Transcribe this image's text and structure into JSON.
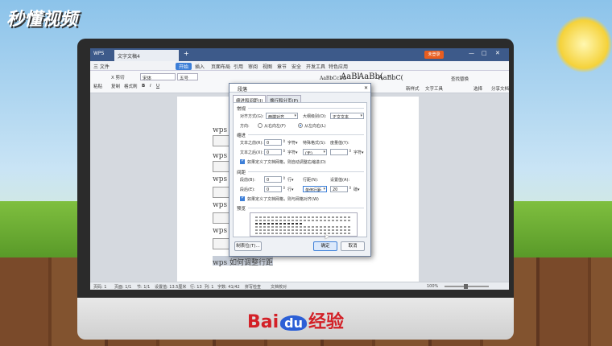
{
  "watermark": "秒懂视频",
  "brand": {
    "prefix": "Bai",
    "du": "du",
    "suffix": "经验"
  },
  "titlebar": {
    "app": "WPS",
    "tab": "文字文稿4",
    "plus": "+",
    "login": "未登录",
    "min": "—",
    "max": "□",
    "close": "✕"
  },
  "menu": [
    "三 文件",
    "开始",
    "插入",
    "页面布局",
    "引用",
    "审阅",
    "视图",
    "章节",
    "安全",
    "开发工具",
    "特色应用"
  ],
  "ribbon": {
    "paste": "粘贴",
    "cut": "X 剪切",
    "copy": "复制",
    "format_painter": "格式刷",
    "font_name": "宋体",
    "font_size": "五号",
    "style_normal": "AaBbCcDd",
    "style_h1": "AaBl",
    "style_h2": "AaBb(",
    "style_h3": "AaBbC(",
    "find_replace": "查找替换",
    "select": "选择",
    "text_tool": "文字工具",
    "new_style": "新样式",
    "share": "分享文档"
  },
  "document": {
    "line": "wps 如何调整行距",
    "repeat_text": "wps"
  },
  "statusbar": {
    "page": "页码: 1",
    "pages": "页面: 1/1",
    "section": "节: 1/1",
    "setting": "设置值: 13.5厘米",
    "row": "行: 13",
    "col": "列: 1",
    "words": "字数: 41/42",
    "spell": "拼写检查",
    "doc_check": "文档校对",
    "zoom": "100%"
  },
  "dialog": {
    "title": "段落",
    "close": "✕",
    "tab_indent": "缩进和间距(I)",
    "tab_break": "换行和分页(P)",
    "sec_general": "常规",
    "align_label": "对齐方式(G):",
    "align_value": "两端对齐",
    "outline_label": "大纲级别(O):",
    "outline_value": "正文文本",
    "direction_label": "方向:",
    "dir_rtl": "从右向左(F)",
    "dir_ltr": "从左向右(L)",
    "sec_indent": "缩进",
    "before_text_label": "文本之前(R):",
    "before_text_value": "0",
    "before_text_unit": "字符▾",
    "special_label": "特殊格式(S):",
    "special_value": "(无)",
    "measure_label": "度量值(Y):",
    "after_text_label": "文本之后(X):",
    "after_text_value": "0",
    "after_text_unit": "字符▾",
    "measure_unit": "字符▾",
    "indent_grid": "如果定义了文档网格，则自动调整右缩进(D)",
    "sec_spacing": "间距",
    "before_label": "段前(B):",
    "before_value": "0",
    "before_unit": "行▾",
    "line_label": "行距(N):",
    "line_value": "单倍行距",
    "setval_label": "设置值(A):",
    "setval_value": "20",
    "setval_unit": "磅▾",
    "after_label": "段后(E):",
    "after_value": "0",
    "after_unit": "行▾",
    "spacing_grid": "如果定义了文档网格，则与网格对齐(W)",
    "sec_preview": "预览",
    "tabs_button": "制表位(T)...",
    "ok_button": "确定",
    "cancel_button": "取消"
  }
}
